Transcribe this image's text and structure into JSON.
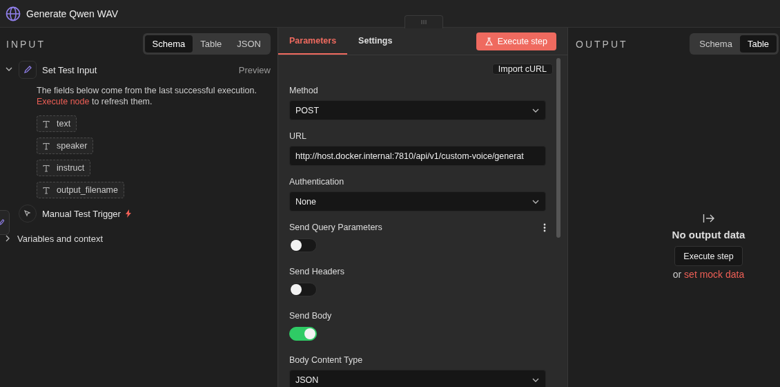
{
  "window": {
    "title": "Generate Qwen WAV"
  },
  "input": {
    "title": "INPUT",
    "view_tabs": [
      {
        "label": "Schema",
        "selected": true
      },
      {
        "label": "Table",
        "selected": false
      },
      {
        "label": "JSON",
        "selected": false
      }
    ],
    "nodes": [
      {
        "kind": "set",
        "name": "Set Test Input",
        "expanded": true,
        "action": "Preview",
        "notice": "The fields below come from the last successful execution.",
        "notice_link": "Execute node",
        "notice_after": "to refresh them.",
        "fields": [
          "text",
          "speaker",
          "instruct",
          "output_filename"
        ]
      },
      {
        "kind": "trigger",
        "name": "Manual Test Trigger"
      }
    ],
    "context": {
      "label": "Variables and context",
      "expanded": false
    }
  },
  "parameters": {
    "tabs": [
      {
        "label": "Parameters",
        "selected": true
      },
      {
        "label": "Settings",
        "selected": false
      }
    ],
    "execute_button": "Execute step",
    "import_button": "Import cURL",
    "fields": [
      {
        "kind": "select",
        "label": "Method",
        "value": "POST"
      },
      {
        "kind": "input",
        "label": "URL",
        "value": "http://host.docker.internal:7810/api/v1/custom-voice/generat"
      },
      {
        "kind": "select",
        "label": "Authentication",
        "value": "None"
      },
      {
        "kind": "toggle",
        "label": "Send Query Parameters",
        "on": false,
        "menu": true
      },
      {
        "kind": "toggle",
        "label": "Send Headers",
        "on": false
      },
      {
        "kind": "toggle",
        "label": "Send Body",
        "on": true
      },
      {
        "kind": "select",
        "label": "Body Content Type",
        "value": "JSON"
      }
    ]
  },
  "output": {
    "title": "OUTPUT",
    "view_tabs": [
      {
        "label": "Schema",
        "selected": false
      },
      {
        "label": "Table",
        "selected": true
      }
    ],
    "empty_title": "No output data",
    "button": "Execute step",
    "or_text": "or",
    "mock_link": "set mock data"
  }
}
